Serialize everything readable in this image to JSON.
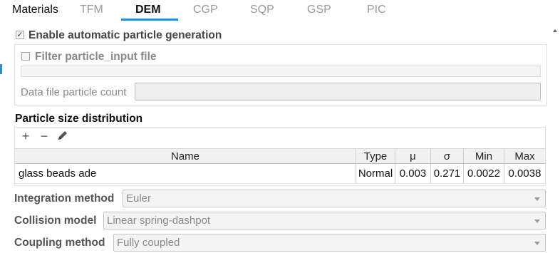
{
  "tabs": [
    {
      "label": "Materials"
    },
    {
      "label": "TFM"
    },
    {
      "label": "DEM"
    },
    {
      "label": "CGP"
    },
    {
      "label": "SQP"
    },
    {
      "label": "GSP"
    },
    {
      "label": "PIC"
    }
  ],
  "active_tab": "DEM",
  "enable_auto": {
    "label": "Enable automatic particle generation",
    "checked": true,
    "check_glyph": "✓"
  },
  "filter_input": {
    "label": "Filter particle_input file",
    "checked": false
  },
  "data_file_count": {
    "label": "Data file particle count",
    "value": ""
  },
  "psd": {
    "title": "Particle size distribution",
    "toolbar": {
      "add": "+",
      "remove": "−"
    },
    "columns": [
      "Name",
      "Type",
      "μ",
      "σ",
      "Min",
      "Max"
    ],
    "rows": [
      {
        "name": "glass beads ade",
        "type": "Normal",
        "mu": "0.003",
        "sigma": "0.271",
        "min": "0.0022",
        "max": "0.0038"
      }
    ]
  },
  "integration_method": {
    "label": "Integration method",
    "value": "Euler"
  },
  "collision_model": {
    "label": "Collision model",
    "value": "Linear spring-dashpot"
  },
  "coupling_method": {
    "label": "Coupling method",
    "value": "Fully coupled"
  },
  "colors": {
    "accent": "#2a8fd6"
  }
}
